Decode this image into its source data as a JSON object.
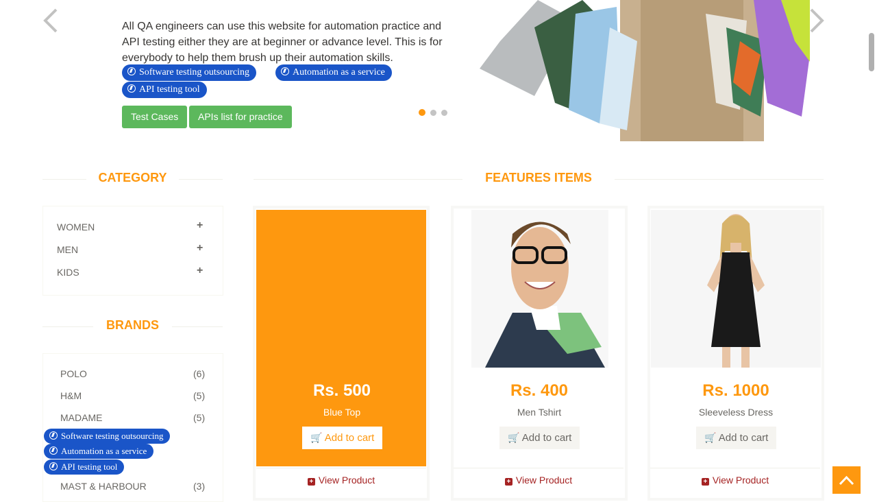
{
  "slider": {
    "description": "All QA engineers can use this website for automation practice and API testing either they are at beginner or advance level. This is for everybody to help them brush up their automation skills.",
    "chips": [
      "Software testing outsourcing",
      "Automation as a service",
      "API testing tool"
    ],
    "buttons": {
      "test_cases": "Test Cases",
      "apis_list": "APIs list for practice"
    },
    "prev_icon": "chevron-left-icon",
    "next_icon": "chevron-right-icon"
  },
  "sidebar": {
    "category_title": "CATEGORY",
    "categories": [
      {
        "label": "WOMEN",
        "icon": "plus-icon"
      },
      {
        "label": "MEN",
        "icon": "plus-icon"
      },
      {
        "label": "KIDS",
        "icon": "plus-icon"
      }
    ],
    "brands_title": "BRANDS",
    "brands": [
      {
        "name": "POLO",
        "count": "(6)"
      },
      {
        "name": "H&M",
        "count": "(5)"
      },
      {
        "name": "MADAME",
        "count": "(5)"
      },
      {
        "name": "MAST & HARBOUR",
        "count": "(3)"
      }
    ],
    "chips": [
      "Software testing outsourcing",
      "Automation as a service",
      "API testing tool"
    ]
  },
  "features": {
    "title": "FEATURES ITEMS",
    "products": [
      {
        "price": "Rs. 500",
        "name": "Blue Top",
        "add_to_cart": "Add to cart",
        "view": "View Product"
      },
      {
        "price": "Rs. 400",
        "name": "Men Tshirt",
        "add_to_cart": "Add to cart",
        "view": "View Product"
      },
      {
        "price": "Rs. 1000",
        "name": "Sleeveless Dress",
        "add_to_cart": "Add to cart",
        "view": "View Product"
      }
    ]
  },
  "colors": {
    "accent": "#FE980F",
    "green": "#5CB85C",
    "chip_blue": "#1A55C8",
    "link_red": "#A52323"
  }
}
